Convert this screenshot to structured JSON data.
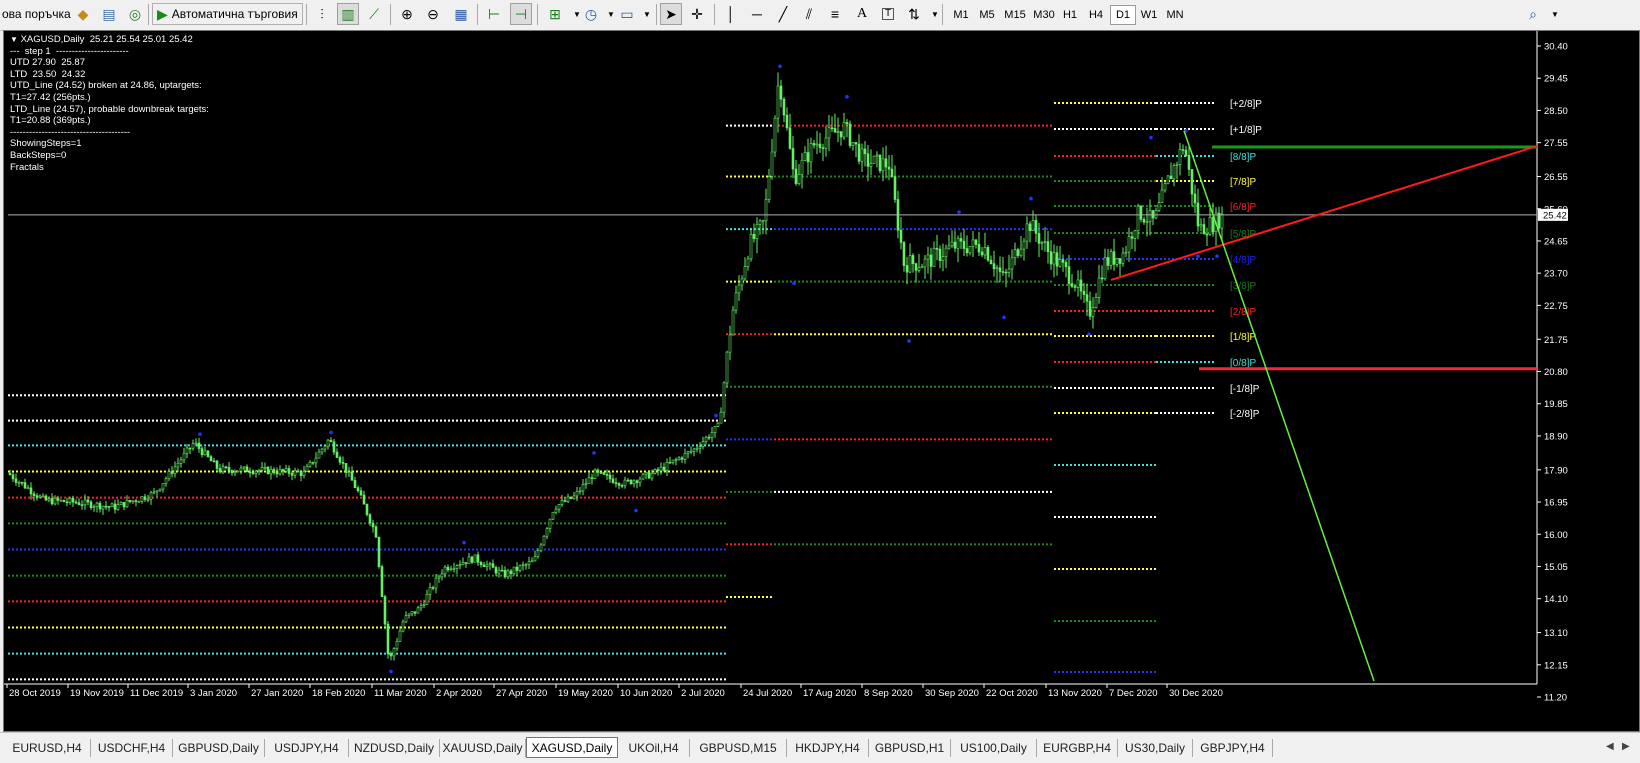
{
  "toolbar": {
    "new_order_label": "ова поръчка",
    "auto_trading_label": "Автоматична търговия",
    "timeframes": [
      "M1",
      "M5",
      "M15",
      "M30",
      "H1",
      "H4",
      "D1",
      "W1",
      "MN"
    ],
    "active_timeframe": "D1"
  },
  "chart": {
    "symbol_header": "XAGUSD,Daily  25.21 25.54 25.01 25.42",
    "info_lines": [
      "---  step 1  -----------------------",
      "UTD 27.90  25.87",
      "LTD  23.50  24.32",
      "UTD_Line (24.52) broken at 24.86, uptargets:",
      "T1=27.42 (256pts.)",
      "LTD_Line (24.57), probable downbreak targets:",
      "T1=20.88 (369pts.)",
      "--------------------------------------",
      "ShowingSteps=1",
      "BackSteps=0",
      "Fractals"
    ],
    "current_price": "25.42",
    "price_ticks": [
      "30.40",
      "29.45",
      "28.50",
      "27.55",
      "26.55",
      "25.60",
      "24.65",
      "23.70",
      "22.75",
      "21.75",
      "20.80",
      "19.85",
      "18.90",
      "17.90",
      "16.95",
      "16.00",
      "15.05",
      "14.10",
      "13.10",
      "12.15",
      "11.20"
    ],
    "date_ticks": [
      "28 Oct 2019",
      "19 Nov 2019",
      "11 Dec 2019",
      "3 Jan 2020",
      "27 Jan 2020",
      "18 Feb 2020",
      "11 Mar 2020",
      "2 Apr 2020",
      "27 Apr 2020",
      "19 May 2020",
      "10 Jun 2020",
      "2 Jul 2020",
      "24 Jul 2020",
      "17 Aug 2020",
      "8 Sep 2020",
      "30 Sep 2020",
      "22 Oct 2020",
      "13 Nov 2020",
      "7 Dec 2020",
      "30 Dec 2020"
    ],
    "murrey_labels": [
      {
        "text": "[+2/8]P",
        "color": "#ffffff"
      },
      {
        "text": "[+1/8]P",
        "color": "#ffffff"
      },
      {
        "text": "[8/8]P",
        "color": "#3fe0e0"
      },
      {
        "text": "[7/8]P",
        "color": "#ffff40"
      },
      {
        "text": "[6/8]P",
        "color": "#ff2020"
      },
      {
        "text": "[5/8]P",
        "color": "#1a7a1a"
      },
      {
        "text": "[4/8]P",
        "color": "#2020ff"
      },
      {
        "text": "[3/8]P",
        "color": "#1a7a1a"
      },
      {
        "text": "[2/8]P",
        "color": "#ff2020"
      },
      {
        "text": "[1/8]P",
        "color": "#ffff40"
      },
      {
        "text": "[0/8]P",
        "color": "#3fe0e0"
      },
      {
        "text": "[-1/8]P",
        "color": "#ffffff"
      },
      {
        "text": "[-2/8]P",
        "color": "#ffffff"
      }
    ],
    "colors": {
      "background": "#000000",
      "candles": "#66ee66",
      "fractals": "#2233ff",
      "target_up": "#1a9a1a",
      "target_down": "#ff2040",
      "trend_line": "#ff1a1a",
      "down_line": "#66ee44"
    }
  },
  "tabs": [
    {
      "label": "EURUSD,H4",
      "active": false
    },
    {
      "label": "USDCHF,H4",
      "active": false
    },
    {
      "label": "GBPUSD,Daily",
      "active": false
    },
    {
      "label": "USDJPY,H4",
      "active": false
    },
    {
      "label": "NZDUSD,Daily",
      "active": false
    },
    {
      "label": "XAUUSD,Daily",
      "active": false
    },
    {
      "label": "XAGUSD,Daily",
      "active": true
    },
    {
      "label": "UKOil,H4",
      "active": false
    },
    {
      "label": "GBPUSD,M15",
      "active": false
    },
    {
      "label": "HKDJPY,H4",
      "active": false
    },
    {
      "label": "GBPUSD,H1",
      "active": false
    },
    {
      "label": "US100,Daily",
      "active": false
    },
    {
      "label": "EURGBP,H4",
      "active": false
    },
    {
      "label": "US30,Daily",
      "active": false
    },
    {
      "label": "GBPJPY,H4",
      "active": false
    }
  ]
}
